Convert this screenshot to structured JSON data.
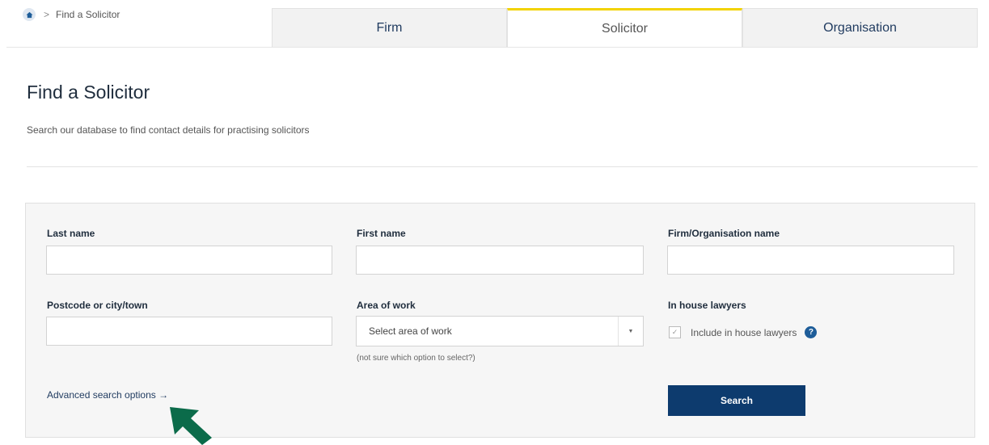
{
  "breadcrumb": {
    "current": "Find a Solicitor",
    "separator": ">"
  },
  "tabs": [
    {
      "label": "Firm",
      "active": false
    },
    {
      "label": "Solicitor",
      "active": true
    },
    {
      "label": "Organisation",
      "active": false
    }
  ],
  "header": {
    "title": "Find a Solicitor",
    "subtitle": "Search our database to find contact details for practising solicitors"
  },
  "form": {
    "last_name": {
      "label": "Last name",
      "value": ""
    },
    "first_name": {
      "label": "First name",
      "value": ""
    },
    "firm_name": {
      "label": "Firm/Organisation name",
      "value": ""
    },
    "postcode": {
      "label": "Postcode or city/town",
      "value": ""
    },
    "area_of_work": {
      "label": "Area of work",
      "selected": "Select area of work",
      "hint": "(not sure which option to select?)"
    },
    "in_house": {
      "label": "In house lawyers",
      "checkbox_label": "Include in house lawyers",
      "checked": true,
      "help": "?"
    },
    "advanced_link": "Advanced search options →",
    "search_button": "Search"
  },
  "icons": [
    "home-icon",
    "chevron-right-icon",
    "chevron-down-icon",
    "checkmark-icon",
    "help-icon",
    "pointer-arrow-icon"
  ],
  "colors": {
    "accent": "#f2d200",
    "primary": "#0d3b6e",
    "help": "#1e5d99",
    "arrow": "#0b6b4a"
  }
}
